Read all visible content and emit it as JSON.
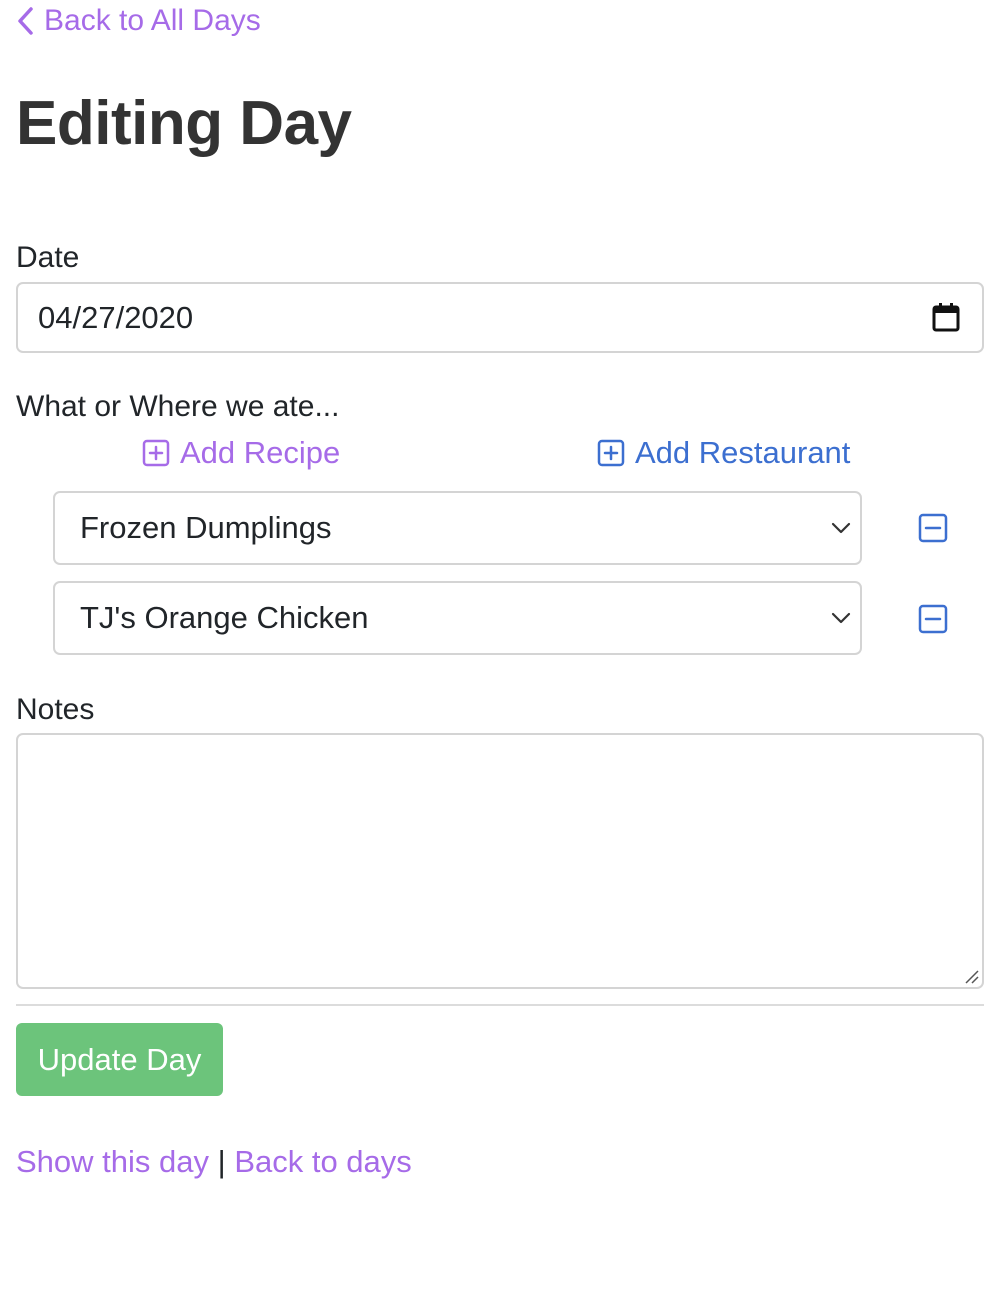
{
  "nav": {
    "back_label": "Back to All Days"
  },
  "page": {
    "title": "Editing Day"
  },
  "form": {
    "date_label": "Date",
    "date_value": "04/27/2020",
    "meals_label": "What or Where we ate...",
    "add_recipe_label": "Add Recipe",
    "add_restaurant_label": "Add Restaurant",
    "meals": [
      {
        "selected": "Frozen Dumplings"
      },
      {
        "selected": "TJ's Orange Chicken"
      }
    ],
    "notes_label": "Notes",
    "notes_value": "",
    "submit_label": "Update Day"
  },
  "footer": {
    "show_label": "Show this day",
    "separator": "|",
    "back_label": "Back to days"
  },
  "colors": {
    "link_purple": "#a66be8",
    "link_blue": "#3c6fd0",
    "submit_green": "#6cc47b"
  },
  "icons": {
    "back": "chevron-left-icon",
    "calendar": "calendar-icon",
    "add": "plus-square-icon",
    "dropdown": "chevron-down-icon",
    "remove": "minus-square-icon",
    "resize": "resize-grip-icon"
  }
}
